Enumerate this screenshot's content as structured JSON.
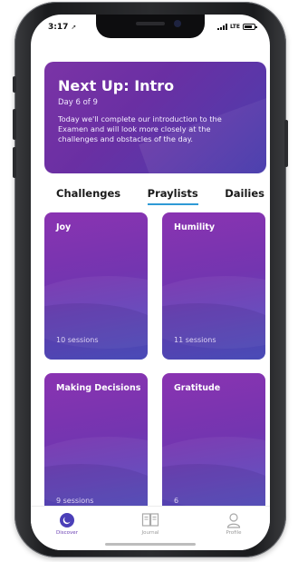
{
  "status": {
    "time": "3:17",
    "network": "LTE"
  },
  "hero": {
    "title": "Next Up: Intro",
    "subtitle": "Day 6 of 9",
    "description": "Today we'll complete our introduction to the Examen and will look more closely at the challenges and obstacles of the day."
  },
  "tabs": [
    {
      "label": "Challenges",
      "active": false
    },
    {
      "label": "Praylists",
      "active": true
    },
    {
      "label": "Dailies",
      "active": false
    }
  ],
  "cards": [
    {
      "title": "Joy",
      "sessions": "10 sessions"
    },
    {
      "title": "Humility",
      "sessions": "11 sessions"
    },
    {
      "title": "Making Decisions",
      "sessions": "9 sessions"
    },
    {
      "title": "Gratitude",
      "sessions": "6"
    }
  ],
  "tabbar": [
    {
      "label": "Discover",
      "icon": "discover-icon",
      "active": true
    },
    {
      "label": "Journal",
      "icon": "journal-icon",
      "active": false
    },
    {
      "label": "Profile",
      "icon": "profile-icon",
      "active": false
    }
  ],
  "colors": {
    "accent": "#2f9ad6",
    "brand_purple": "#7335b0"
  }
}
